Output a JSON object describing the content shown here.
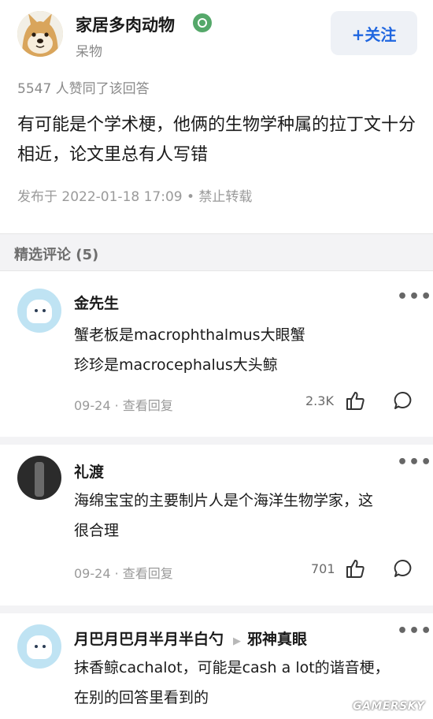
{
  "answer": {
    "author_name": "家居多肉动物",
    "author_sub": "呆物",
    "follow_label": "+关注",
    "likes_line": "5547 人赞同了该回答",
    "text": "有可能是个学术梗，他俩的生物学种属的拉丁文十分相近，论文里总有人写错",
    "meta": "发布于 2022-01-18 17:09 • 禁止转载"
  },
  "comments_section": {
    "title": "精选评论 (5)"
  },
  "comments": [
    {
      "name": "金先生",
      "lines": [
        "蟹老板是macrophthalmus大眼蟹",
        "珍珍是macrocephalus大头鲸"
      ],
      "meta": "09-24 · 查看回复",
      "likes": "2.3K"
    },
    {
      "name": "礼渡",
      "lines": [
        "海绵宝宝的主要制片人是个海洋生物学家，这",
        "很合理"
      ],
      "meta": "09-24 · 查看回复",
      "likes": "701"
    },
    {
      "name": "月巴月巴月半月半白勺",
      "reply_to": "邪神真眼",
      "lines": [
        "抹香鲸cachalot，可能是cash a lot的谐音梗，",
        "在别的回答里看到的"
      ]
    }
  ],
  "more_label": "•••",
  "watermark": "GAMERSKY",
  "icons": {
    "badge": "verified-badge-icon",
    "like": "thumbs-up-icon",
    "reply": "comment-bubble-icon",
    "more": "more-dots-icon",
    "arrow": "reply-arrow-icon"
  },
  "colors": {
    "accent": "#1f66e0",
    "badge": "#55a86a",
    "muted": "#9a9a9a",
    "section_bg": "#f3f3f5"
  }
}
